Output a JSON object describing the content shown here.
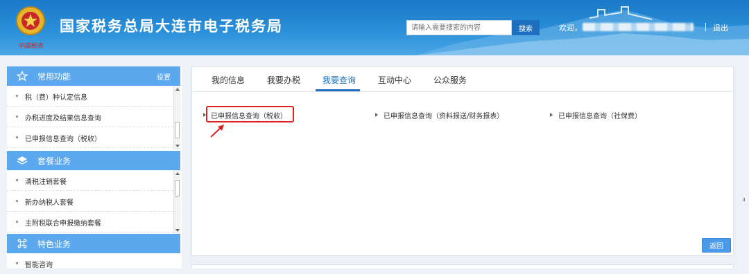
{
  "header": {
    "emblem_caption": "中国税务",
    "title": "国家税务总局大连市电子税务局",
    "search": {
      "placeholder": "请输入需要搜索的内容",
      "button_label": "搜索"
    },
    "welcome_text": "欢迎，",
    "logout_label": "退出"
  },
  "sidebar": {
    "sections": [
      {
        "icon": "star-icon",
        "title": "常用功能",
        "settings_label": "设置",
        "items": [
          "税（费）种认定信息",
          "办税进度及结果信息查询",
          "已申报信息查询（税收）"
        ]
      },
      {
        "icon": "layers-icon",
        "title": "套餐业务",
        "items": [
          "清税注销套餐",
          "新办纳税人套餐",
          "主附税联合申报缴纳套餐"
        ]
      },
      {
        "icon": "command-icon",
        "title": "特色业务",
        "items": [
          "智能咨询"
        ]
      }
    ]
  },
  "main": {
    "tabs": [
      {
        "label": "我的信息",
        "active": false
      },
      {
        "label": "我要办税",
        "active": false
      },
      {
        "label": "我要查询",
        "active": true
      },
      {
        "label": "互动中心",
        "active": false
      },
      {
        "label": "公众服务",
        "active": false
      }
    ],
    "query_links": [
      "已申报信息查询（税收）",
      "已申报信息查询（资料报送/财务报表）",
      "已申报信息查询（社保费）"
    ],
    "back_label": "返回"
  },
  "colors": {
    "header_blue": "#1a78c8",
    "section_blue": "#5ba8ee",
    "accent_blue": "#1e6fc0",
    "highlight_red": "#e02020"
  }
}
